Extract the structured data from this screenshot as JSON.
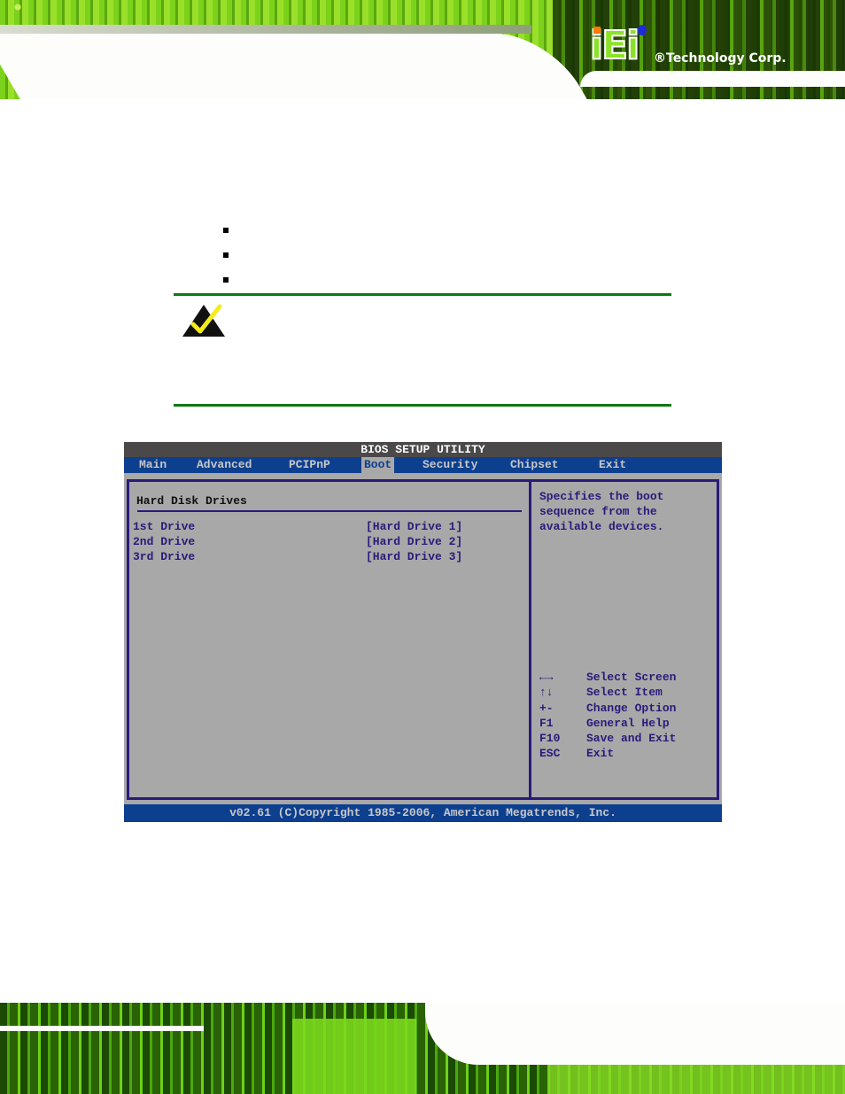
{
  "brand": {
    "logo_letters": "iEi",
    "tagline": "®Technology Corp."
  },
  "note": {
    "icon": "note-check-icon"
  },
  "bios": {
    "title": "BIOS SETUP UTILITY",
    "menu": [
      {
        "label": "Main",
        "active": false
      },
      {
        "label": "Advanced",
        "active": false
      },
      {
        "label": "PCIPnP",
        "active": false
      },
      {
        "label": "Boot",
        "active": true
      },
      {
        "label": "Security",
        "active": false
      },
      {
        "label": "Chipset",
        "active": false
      },
      {
        "label": "Exit",
        "active": false
      }
    ],
    "section_title": "Hard Disk Drives",
    "drives": [
      {
        "label": "1st Drive",
        "value": "[Hard Drive 1]"
      },
      {
        "label": "2nd Drive",
        "value": "[Hard Drive 2]"
      },
      {
        "label": "3rd Drive",
        "value": "[Hard Drive 3]"
      }
    ],
    "help": [
      "Specifies the boot",
      "sequence from the",
      "available devices."
    ],
    "keys": [
      {
        "key": "←→",
        "desc": "Select Screen"
      },
      {
        "key": "↑↓",
        "desc": "Select Item"
      },
      {
        "key": "+-",
        "desc": "Change Option"
      },
      {
        "key": "F1",
        "desc": "General Help"
      },
      {
        "key": "F10",
        "desc": "Save and Exit"
      },
      {
        "key": "ESC",
        "desc": "Exit"
      }
    ],
    "footer": "v02.61 (C)Copyright 1985-2006, American Megatrends, Inc.",
    "colors": {
      "menubar": "#0d3f8f",
      "titlebar": "#4a4848",
      "panel": "#a8a8a8",
      "text": "#2a1a7a"
    }
  },
  "colors": {
    "note_rule": "#0a7a10",
    "brand_green": "#8ce22a"
  }
}
